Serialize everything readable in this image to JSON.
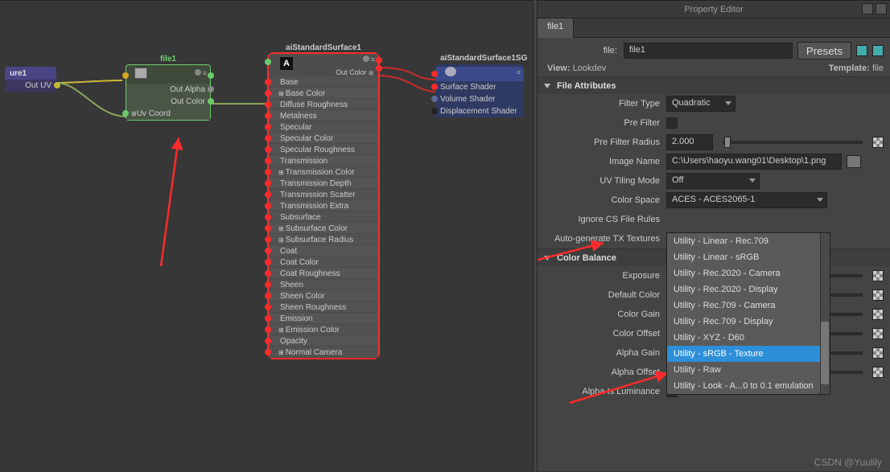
{
  "graph": {
    "nodes": {
      "place2d": {
        "title": "ure1",
        "outs": [
          "Out UV"
        ]
      },
      "file": {
        "title": "file1",
        "outs": [
          "Out Alpha",
          "Out Color"
        ],
        "ins": [
          "Uv Coord"
        ]
      },
      "surface": {
        "title": "aiStandardSurface1",
        "out": "Out Color",
        "attrs": [
          "Base",
          "Base Color",
          "Diffuse Roughness",
          "Metalness",
          "Specular",
          "Specular Color",
          "Specular Roughness",
          "Transmission",
          "Transmission Color",
          "Transmission Depth",
          "Transmission Scatter",
          "Transmission Extra Roughness",
          "Subsurface",
          "Subsurface Color",
          "Subsurface Radius",
          "Coat",
          "Coat Color",
          "Coat Roughness",
          "Sheen",
          "Sheen Color",
          "Sheen Roughness",
          "Emission",
          "Emission Color",
          "Opacity",
          "Normal Camera"
        ]
      },
      "sg": {
        "title": "aiStandardSurface1SG",
        "ins": [
          "Surface Shader",
          "Volume Shader",
          "Displacement Shader"
        ]
      }
    }
  },
  "panel": {
    "title": "Property Editor",
    "tab": "file1",
    "fileLabel": "file:",
    "fileName": "file1",
    "presets": "Presets",
    "viewLabel": "View:",
    "viewValue": "Lookdev",
    "templateLabel": "Template:",
    "templateValue": "file",
    "sections": {
      "fileAttrs": "File Attributes",
      "colorBalance": "Color Balance"
    },
    "attrs": {
      "filterType": {
        "label": "Filter Type",
        "value": "Quadratic"
      },
      "preFilter": {
        "label": "Pre Filter"
      },
      "preFilterRadius": {
        "label": "Pre Filter Radius",
        "value": "2.000"
      },
      "imageName": {
        "label": "Image Name",
        "value": "C:\\Users\\haoyu.wang01\\Desktop\\1.png"
      },
      "uvTiling": {
        "label": "UV Tiling Mode",
        "value": "Off"
      },
      "colorSpace": {
        "label": "Color Space",
        "value": "ACES - ACES2065-1"
      },
      "ignoreCS": {
        "label": "Ignore CS File Rules"
      },
      "autoTX": {
        "label": "Auto-generate TX Textures"
      },
      "exposure": {
        "label": "Exposure"
      },
      "defaultColor": {
        "label": "Default Color"
      },
      "colorGain": {
        "label": "Color Gain"
      },
      "colorOffset": {
        "label": "Color Offset"
      },
      "alphaGain": {
        "label": "Alpha Gain"
      },
      "alphaOffset": {
        "label": "Alpha Offset"
      },
      "alphaLum": {
        "label": "Alpha Is Luminance"
      }
    },
    "dropdown": {
      "options": [
        "Utility - Linear - Rec.709",
        "Utility - Linear - sRGB",
        "Utility - Rec.2020 - Camera",
        "Utility - Rec.2020 - Display",
        "Utility - Rec.709 - Camera",
        "Utility - Rec.709 - Display",
        "Utility - XYZ - D60",
        "Utility - sRGB - Texture",
        "Utility - Raw",
        "Utility - Look - A...0 to 0.1 emulation"
      ],
      "selected": "Utility - sRGB - Texture"
    }
  },
  "watermark": "CSDN @Yuulily"
}
